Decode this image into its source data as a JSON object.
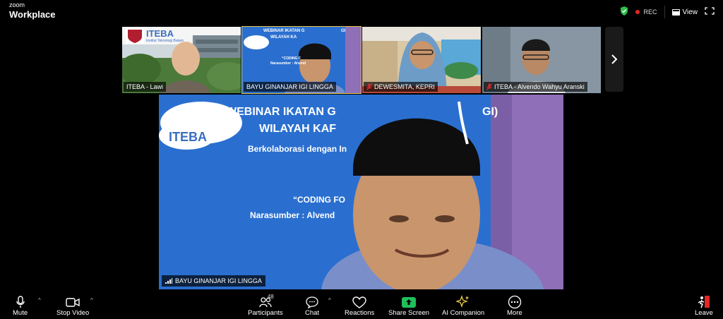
{
  "app": {
    "brand_top": "zoom",
    "brand_bottom": "Workplace"
  },
  "header": {
    "rec_label": "REC",
    "view_label": "View"
  },
  "thumbnails": [
    {
      "name": "ITEBA - Lawi",
      "muted": false,
      "active": false
    },
    {
      "name": "BAYU GINANJAR IGI LINGGA",
      "muted": false,
      "active": true
    },
    {
      "name": "DEWESMITA, KEPRI",
      "muted": true,
      "active": false
    },
    {
      "name": "ITEBA - Alvendo Wahyu Aranski",
      "muted": true,
      "active": false
    }
  ],
  "main": {
    "speaker_name": "BAYU GINANJAR IGI LINGGA",
    "banner_title_1": "WEBINAR IKATAN G",
    "banner_title_1_end": "GI)",
    "banner_title_2": "WILAYAH KAF",
    "banner_sub": "Berkolaborasi dengan In",
    "banner_topic": "“CODING FO",
    "banner_speaker": "Narasumber : Alvend",
    "logo_text": "ITEBA"
  },
  "thumb_texts": {
    "iteba_logo": "ITEBA",
    "iteba_sub": "Institut Teknologi Batam",
    "webinar_line1": "WEBINAR IKATAN G",
    "webinar_line1_end": "GI",
    "webinar_line2": "WILAYAH KA",
    "webinar_topic": "“CODING F",
    "webinar_speaker": "Narasumber : Alvend"
  },
  "toolbar": {
    "mute": "Mute",
    "stop_video": "Stop Video",
    "participants": "Participants",
    "participants_count": "48",
    "chat": "Chat",
    "reactions": "Reactions",
    "share_screen": "Share Screen",
    "ai_companion": "AI Companion",
    "more": "More",
    "leave": "Leave"
  },
  "colors": {
    "accent_green": "#1fbf5a",
    "rec_red": "#e02828",
    "active_border": "#e6c74a",
    "banner_blue": "#2a6fd0"
  }
}
